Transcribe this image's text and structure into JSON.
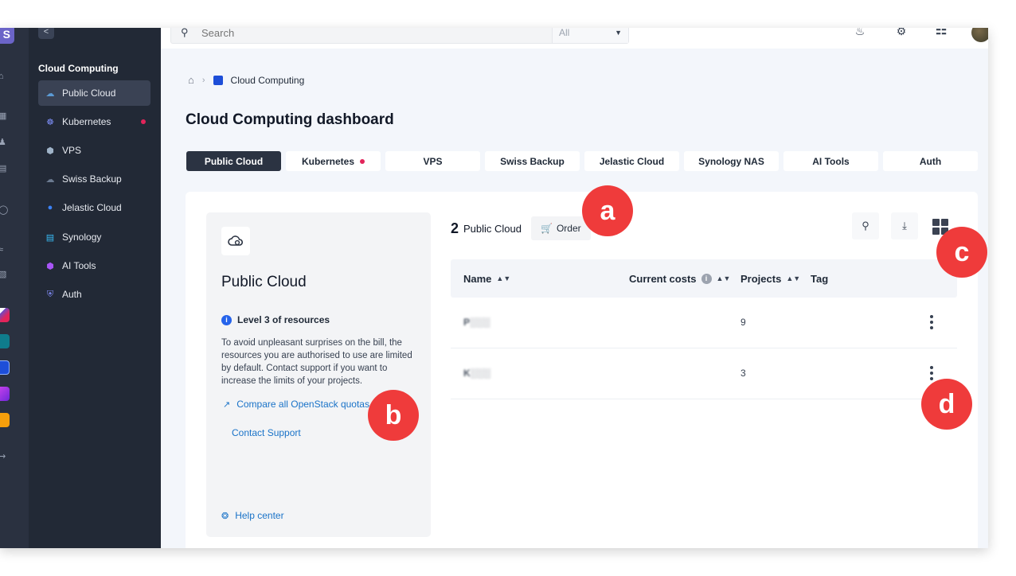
{
  "rail": {
    "avatar_letter": "S"
  },
  "sidebar": {
    "collapse_glyph": "<",
    "section_title": "Cloud Computing",
    "items": [
      {
        "label": "Public Cloud"
      },
      {
        "label": "Kubernetes"
      },
      {
        "label": "VPS"
      },
      {
        "label": "Swiss Backup"
      },
      {
        "label": "Jelastic Cloud"
      },
      {
        "label": "Synology"
      },
      {
        "label": "AI Tools"
      },
      {
        "label": "Auth"
      }
    ]
  },
  "topbar": {
    "search_placeholder": "Search",
    "search_scope": "All"
  },
  "breadcrumb": {
    "current": "Cloud Computing"
  },
  "page_title": "Cloud Computing dashboard",
  "tabs": [
    {
      "label": "Public Cloud"
    },
    {
      "label": "Kubernetes"
    },
    {
      "label": "VPS"
    },
    {
      "label": "Swiss Backup"
    },
    {
      "label": "Jelastic Cloud"
    },
    {
      "label": "Synology NAS"
    },
    {
      "label": "AI Tools"
    },
    {
      "label": "Auth"
    }
  ],
  "info_card": {
    "title": "Public Cloud",
    "level": "Level 3 of resources",
    "description": "To avoid unpleasant surprises on the bill, the resources you are authorised to use are limited by default. Contact support if you want to increase the limits of your projects.",
    "compare_link": "Compare all OpenStack quotas",
    "support_link": "Contact Support",
    "help_link": "Help center"
  },
  "list": {
    "count": "2",
    "title": "Public Cloud",
    "order_label": "Order",
    "columns": [
      "Name",
      "Current costs",
      "Projects",
      "Tag"
    ],
    "rows": [
      {
        "name": "P░░░",
        "projects": "9"
      },
      {
        "name": "K░░░",
        "projects": "3"
      }
    ]
  },
  "annotations": [
    "a",
    "b",
    "c",
    "d"
  ],
  "colors": {
    "accent": "#2b3342",
    "link": "#1a73c8",
    "badge": "#ef3b3b",
    "alert_dot": "#e2245a"
  }
}
